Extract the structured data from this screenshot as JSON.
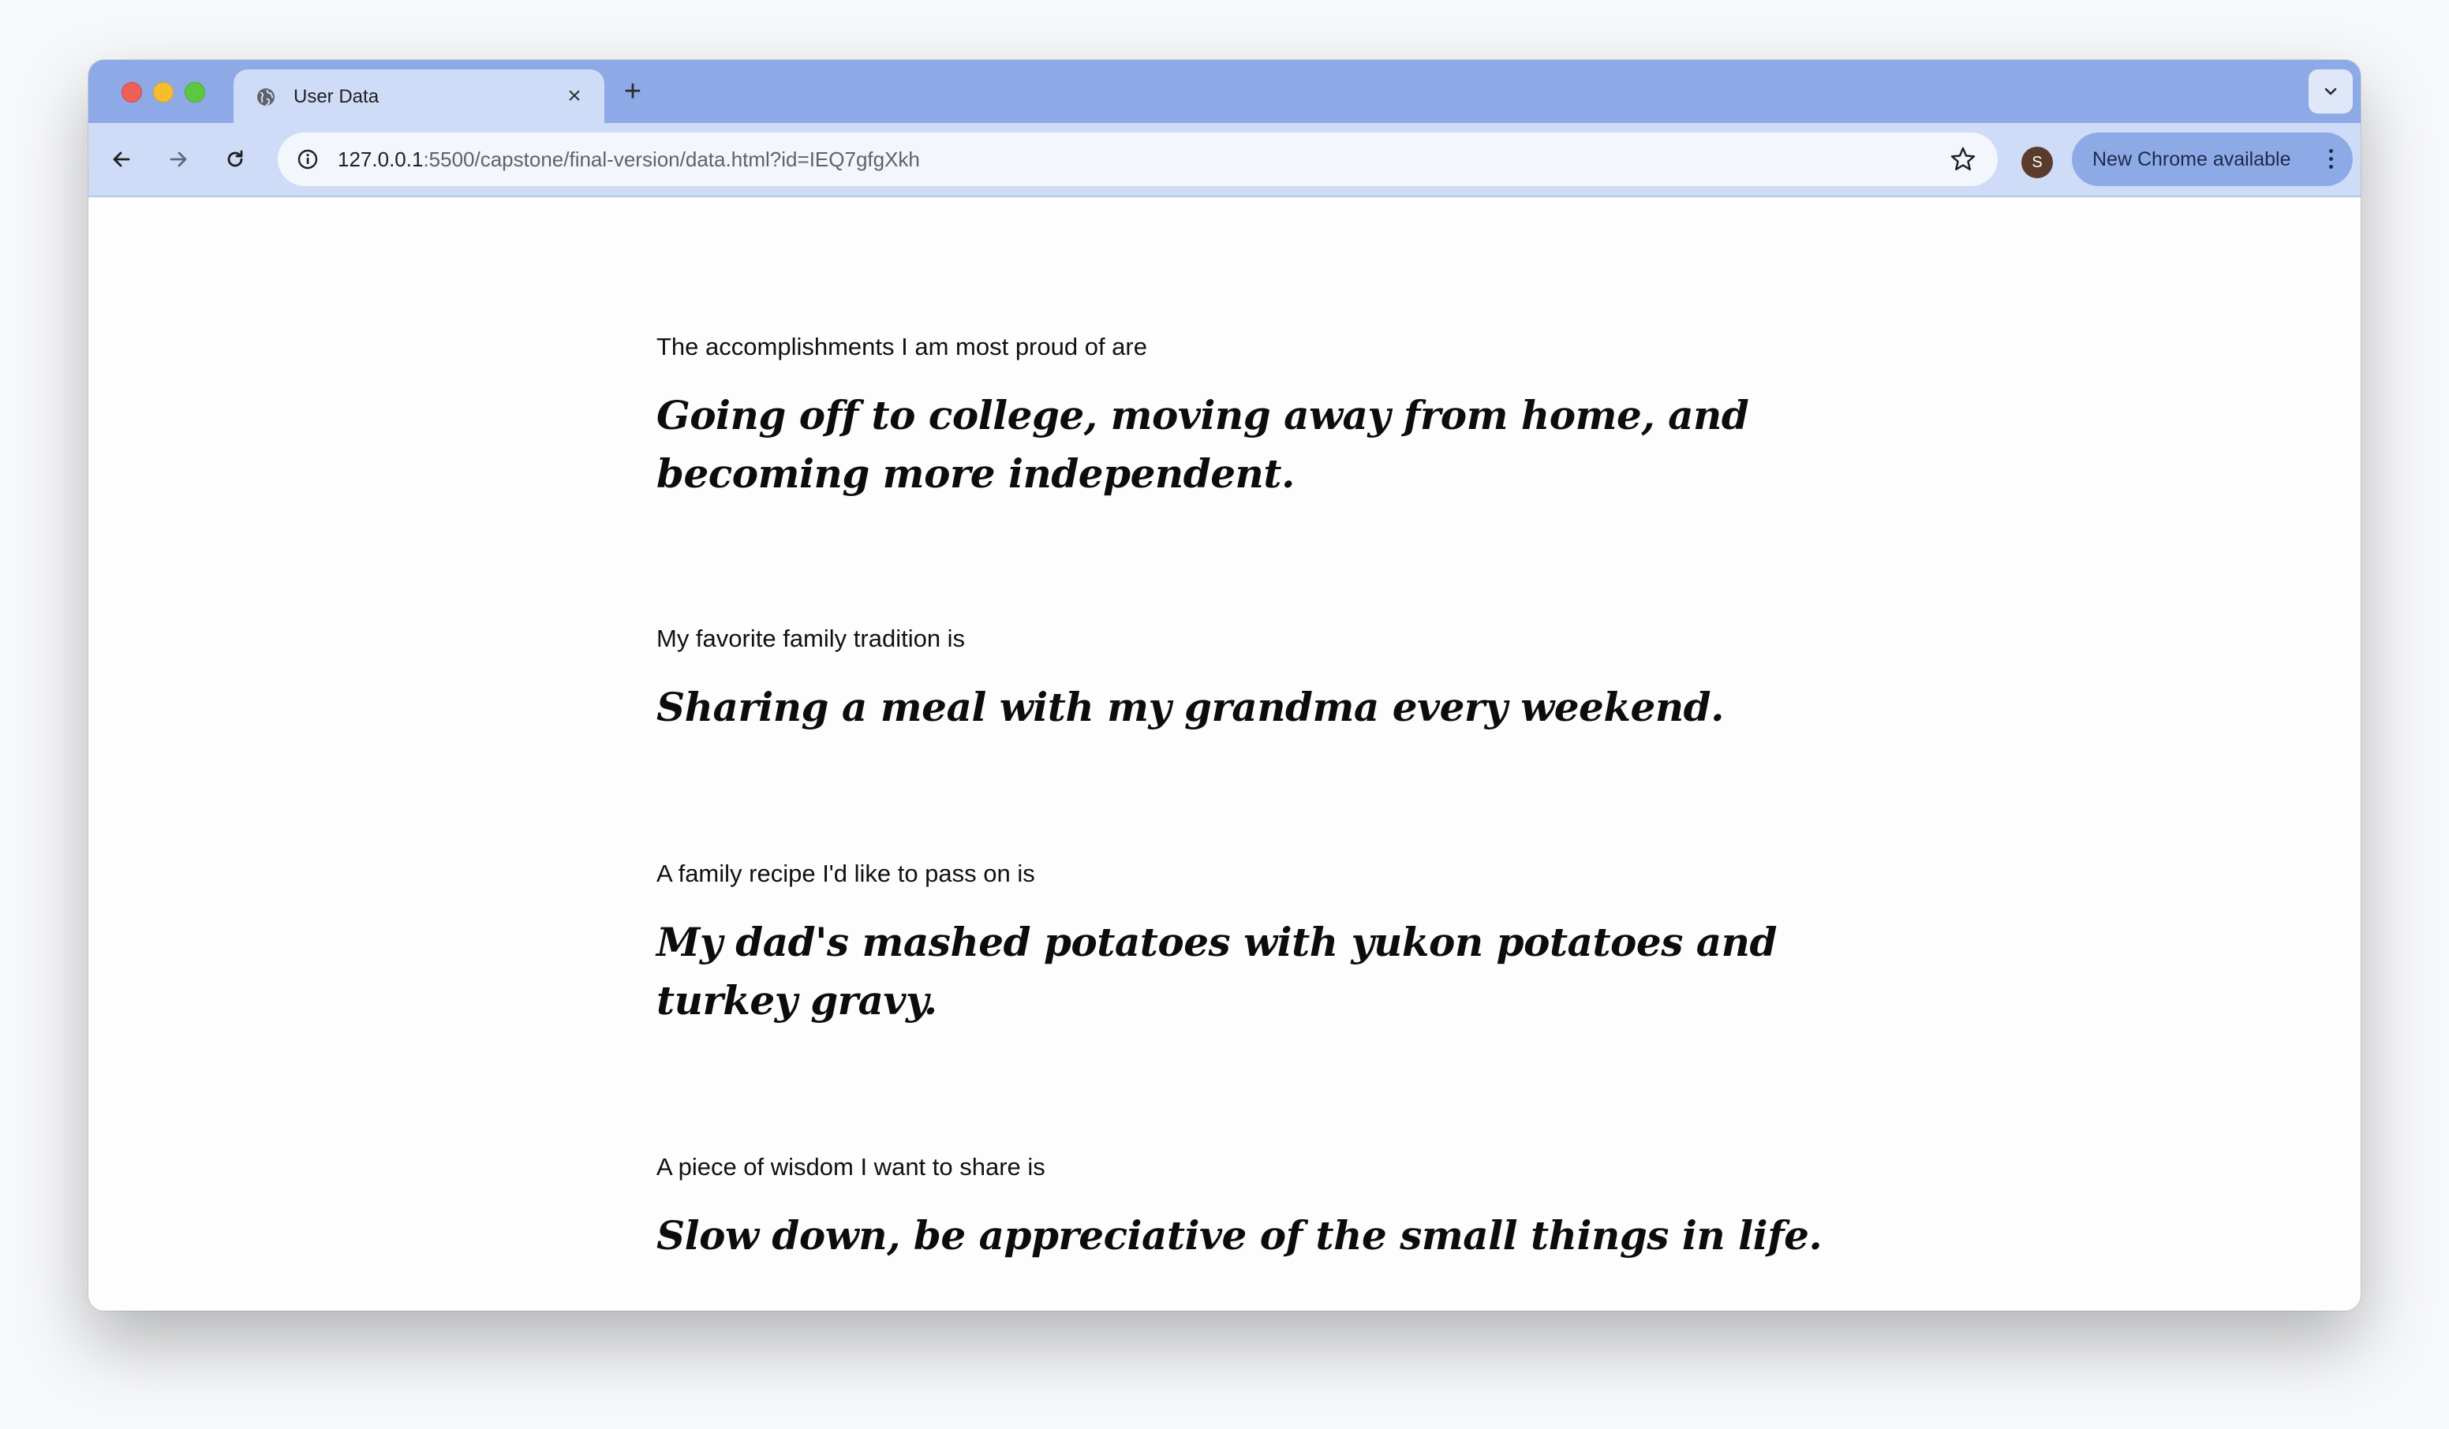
{
  "browser": {
    "tab": {
      "title": "User Data",
      "close_glyph": "×"
    },
    "new_tab_glyph": "+",
    "address_bar": {
      "url_host": "127.0.0.1",
      "url_rest": ":5500/capstone/final-version/data.html?id=IEQ7gfgXkh"
    },
    "profile": {
      "initial": "S"
    },
    "update_button": {
      "label": "New Chrome available"
    }
  },
  "page": {
    "entries": [
      {
        "question": "The accomplishments I am most proud of are",
        "answer": "Going off to college, moving away from home, and becoming more independent."
      },
      {
        "question": "My favorite family tradition is",
        "answer": "Sharing a meal with my grandma every weekend."
      },
      {
        "question": "A family recipe I'd like to pass on is",
        "answer": "My dad's mashed potatoes with yukon potatoes and turkey gravy."
      },
      {
        "question": "A piece of wisdom I want to share is",
        "answer": "Slow down, be appreciative of the small things in life."
      }
    ]
  }
}
